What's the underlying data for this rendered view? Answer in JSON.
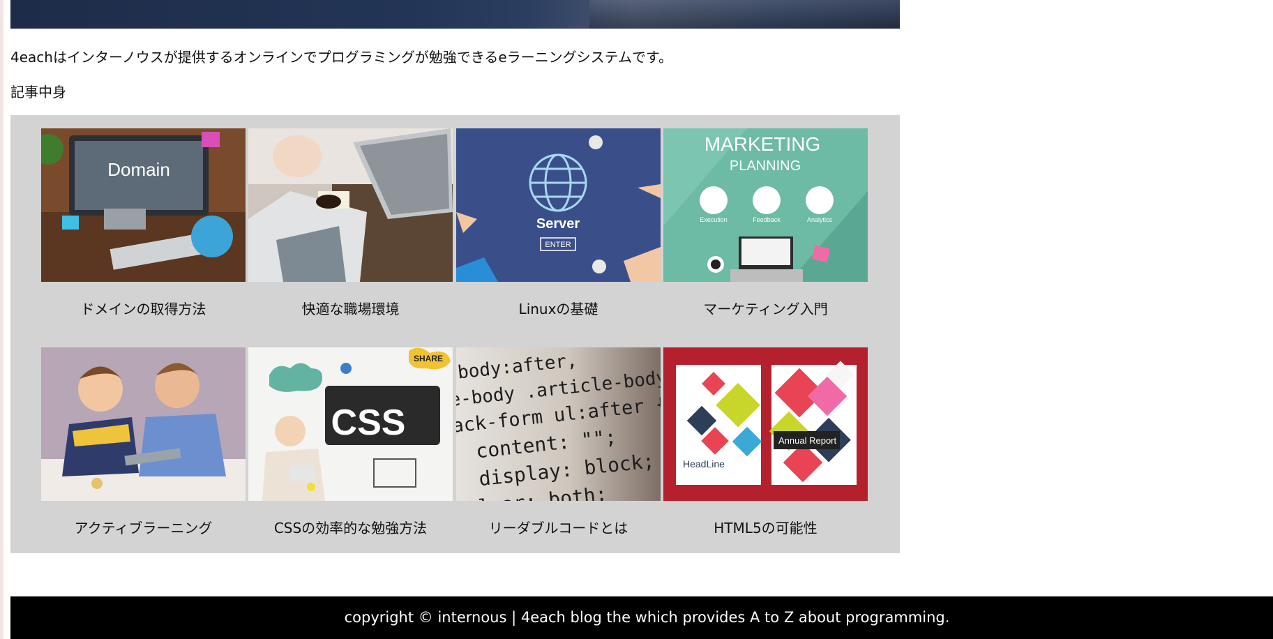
{
  "intro": {
    "text": "4eachはインターノウスが提供するオンラインでプログラミングが勉強できるeラーニングシステムです。"
  },
  "section": {
    "title": "記事中身"
  },
  "articles": [
    {
      "label": "ドメインの取得方法",
      "image_text": "Domain"
    },
    {
      "label": "快適な職場環境"
    },
    {
      "label": "Linuxの基礎",
      "image_text": "Server",
      "image_button": "ENTER"
    },
    {
      "label": "マーケティング入門",
      "image_title": "MARKETING",
      "image_subtitle": "PLANNING",
      "image_items": [
        "Execution",
        "Feedback",
        "Analytics"
      ]
    },
    {
      "label": "アクティブラーニング"
    },
    {
      "label": "CSSの効率的な勉強方法",
      "image_text": "CSS",
      "image_tag": "SHARE"
    },
    {
      "label": "リーダブルコードとは",
      "image_code": [
        "-body:after,",
        "e-body .article-body-more:af",
        "ack-form ul:after {",
        "content: \"\";",
        "display: block;",
        "lear: both;"
      ]
    },
    {
      "label": "HTML5の可能性",
      "image_left": "HeadLine",
      "image_right": "Annual Report"
    }
  ],
  "footer": {
    "text": "copyright © internous | 4each blog the which provides A to Z about programming."
  },
  "colors": {
    "panel": "#d3d3d3",
    "footer_bg": "#000000",
    "footer_text": "#ffffff"
  }
}
